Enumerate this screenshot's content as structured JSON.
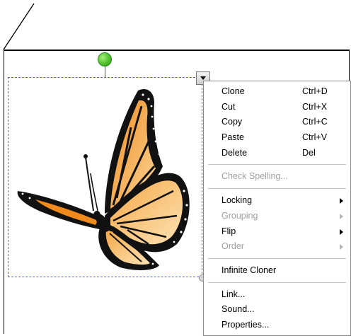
{
  "canvas": {
    "selection_color": "#5a5aff",
    "rotate_handle_color": "#4fc12c"
  },
  "context_menu": {
    "groups": [
      {
        "items": [
          {
            "label": "Clone",
            "shortcut": "Ctrl+D",
            "enabled": true
          },
          {
            "label": "Cut",
            "shortcut": "Ctrl+X",
            "enabled": true
          },
          {
            "label": "Copy",
            "shortcut": "Ctrl+C",
            "enabled": true
          },
          {
            "label": "Paste",
            "shortcut": "Ctrl+V",
            "enabled": true
          },
          {
            "label": "Delete",
            "shortcut": "Del",
            "enabled": true
          }
        ]
      },
      {
        "items": [
          {
            "label": "Check Spelling...",
            "enabled": false
          }
        ]
      },
      {
        "items": [
          {
            "label": "Locking",
            "submenu": true,
            "enabled": true
          },
          {
            "label": "Grouping",
            "submenu": true,
            "enabled": false
          },
          {
            "label": "Flip",
            "submenu": true,
            "enabled": true
          },
          {
            "label": "Order",
            "submenu": true,
            "enabled": false
          }
        ]
      },
      {
        "items": [
          {
            "label": "Infinite Cloner",
            "enabled": true
          }
        ]
      },
      {
        "items": [
          {
            "label": "Link...",
            "enabled": true
          },
          {
            "label": "Sound...",
            "enabled": true
          },
          {
            "label": "Properties...",
            "enabled": true
          }
        ]
      }
    ]
  }
}
